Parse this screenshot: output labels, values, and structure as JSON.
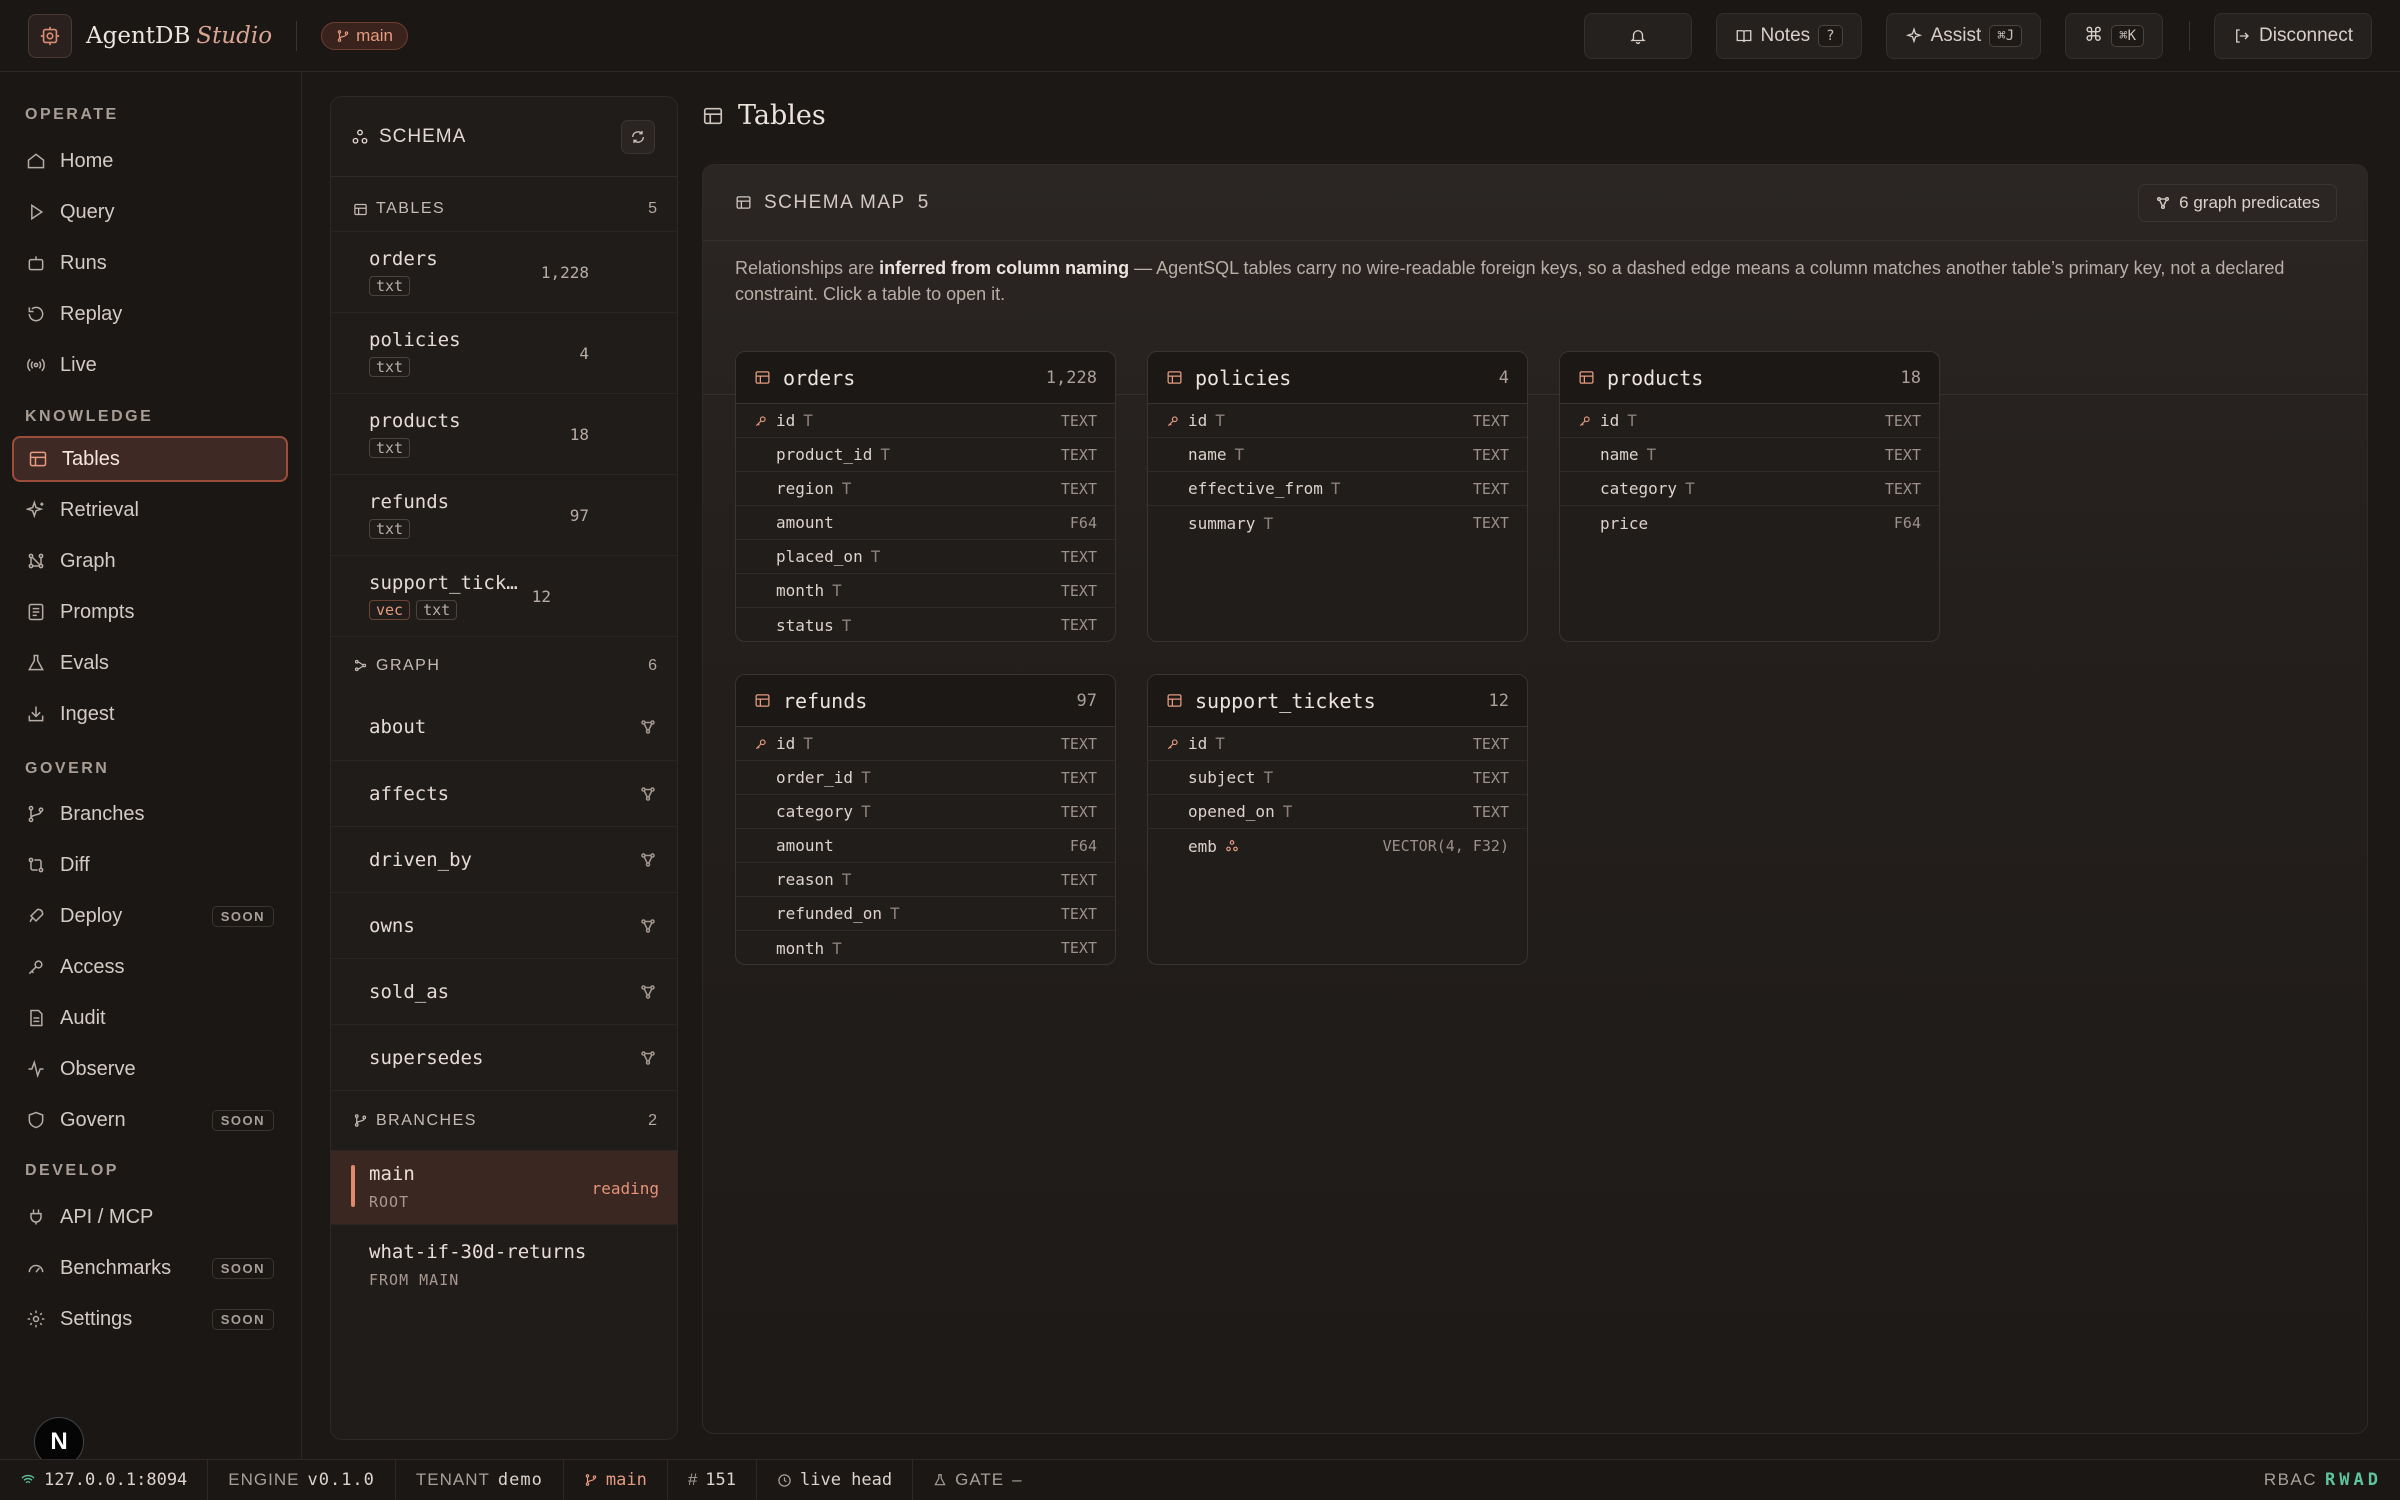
{
  "header": {
    "brand": "AgentDB",
    "brand_suffix": "Studio",
    "branch": "main",
    "notes_label": "Notes",
    "notes_key": "?",
    "assist_label": "Assist",
    "assist_key": "⌘J",
    "cmd_symbol": "⌘",
    "cmd_key": "⌘K",
    "disconnect_label": "Disconnect"
  },
  "sidebar": {
    "sections": [
      "OPERATE",
      "KNOWLEDGE",
      "GOVERN",
      "DEVELOP"
    ],
    "items": [
      {
        "label": "Home",
        "icon": "home-icon"
      },
      {
        "label": "Query",
        "icon": "play-icon"
      },
      {
        "label": "Runs",
        "icon": "bot-icon"
      },
      {
        "label": "Replay",
        "icon": "replay-icon"
      },
      {
        "label": "Live",
        "icon": "broadcast-icon"
      },
      {
        "label": "Tables",
        "icon": "table-icon",
        "active": true
      },
      {
        "label": "Retrieval",
        "icon": "sparkle-icon"
      },
      {
        "label": "Graph",
        "icon": "graph-icon"
      },
      {
        "label": "Prompts",
        "icon": "prompts-icon"
      },
      {
        "label": "Evals",
        "icon": "flask-icon"
      },
      {
        "label": "Ingest",
        "icon": "download-icon"
      },
      {
        "label": "Branches",
        "icon": "branch-icon"
      },
      {
        "label": "Diff",
        "icon": "diff-icon"
      },
      {
        "label": "Deploy",
        "icon": "rocket-icon",
        "badge": "SOON"
      },
      {
        "label": "Access",
        "icon": "key-icon"
      },
      {
        "label": "Audit",
        "icon": "audit-icon"
      },
      {
        "label": "Observe",
        "icon": "activity-icon"
      },
      {
        "label": "Govern",
        "icon": "shield-icon",
        "badge": "SOON"
      },
      {
        "label": "API / MCP",
        "icon": "plug-icon"
      },
      {
        "label": "Benchmarks",
        "icon": "gauge-icon",
        "badge": "SOON"
      },
      {
        "label": "Settings",
        "icon": "gear-icon",
        "badge": "SOON"
      }
    ],
    "avatar_letter": "N"
  },
  "schema": {
    "title": "SCHEMA",
    "tables_label": "TABLES",
    "tables_count": "5",
    "tables": [
      {
        "name": "orders",
        "count": "1,228",
        "tags": [
          "txt"
        ]
      },
      {
        "name": "policies",
        "count": "4",
        "tags": [
          "txt"
        ]
      },
      {
        "name": "products",
        "count": "18",
        "tags": [
          "txt"
        ]
      },
      {
        "name": "refunds",
        "count": "97",
        "tags": [
          "txt"
        ]
      },
      {
        "name": "support_tick…",
        "count": "12",
        "tags": [
          "vec",
          "txt"
        ]
      }
    ],
    "graph_label": "GRAPH",
    "graph_count": "6",
    "predicates": [
      "about",
      "affects",
      "driven_by",
      "owns",
      "sold_as",
      "supersedes"
    ],
    "branches_label": "BRANCHES",
    "branches_count": "2",
    "branches": [
      {
        "name": "main",
        "sub": "ROOT",
        "status": "reading"
      },
      {
        "name": "what-if-30d-returns",
        "sub": "FROM MAIN",
        "status": ""
      }
    ]
  },
  "main": {
    "title": "Tables",
    "map_label": "SCHEMA MAP",
    "map_count": "5",
    "predicates_button": "6 graph predicates",
    "desc_prefix": "Relationships are ",
    "desc_bold": "inferred from column naming",
    "desc_rest": " — AgentSQL tables carry no wire-readable foreign keys, so a dashed edge means a column matches another table’s primary key, not a declared constraint. Click a table to open it.",
    "cards": [
      {
        "name": "orders",
        "count": "1,228",
        "columns": [
          {
            "name": "id",
            "type": "TEXT",
            "key": true,
            "text": true
          },
          {
            "name": "product_id",
            "type": "TEXT",
            "text": true
          },
          {
            "name": "region",
            "type": "TEXT",
            "text": true
          },
          {
            "name": "amount",
            "type": "F64"
          },
          {
            "name": "placed_on",
            "type": "TEXT",
            "text": true
          },
          {
            "name": "month",
            "type": "TEXT",
            "text": true
          },
          {
            "name": "status",
            "type": "TEXT",
            "text": true
          }
        ]
      },
      {
        "name": "policies",
        "count": "4",
        "columns": [
          {
            "name": "id",
            "type": "TEXT",
            "key": true,
            "text": true
          },
          {
            "name": "name",
            "type": "TEXT",
            "text": true
          },
          {
            "name": "effective_from",
            "type": "TEXT",
            "text": true
          },
          {
            "name": "summary",
            "type": "TEXT",
            "text": true
          }
        ]
      },
      {
        "name": "products",
        "count": "18",
        "columns": [
          {
            "name": "id",
            "type": "TEXT",
            "key": true,
            "text": true
          },
          {
            "name": "name",
            "type": "TEXT",
            "text": true
          },
          {
            "name": "category",
            "type": "TEXT",
            "text": true
          },
          {
            "name": "price",
            "type": "F64"
          }
        ]
      },
      {
        "name": "refunds",
        "count": "97",
        "columns": [
          {
            "name": "id",
            "type": "TEXT",
            "key": true,
            "text": true
          },
          {
            "name": "order_id",
            "type": "TEXT",
            "text": true
          },
          {
            "name": "category",
            "type": "TEXT",
            "text": true
          },
          {
            "name": "amount",
            "type": "F64"
          },
          {
            "name": "reason",
            "type": "TEXT",
            "text": true
          },
          {
            "name": "refunded_on",
            "type": "TEXT",
            "text": true
          },
          {
            "name": "month",
            "type": "TEXT",
            "text": true
          }
        ]
      },
      {
        "name": "support_tickets",
        "count": "12",
        "columns": [
          {
            "name": "id",
            "type": "TEXT",
            "key": true,
            "text": true
          },
          {
            "name": "subject",
            "type": "TEXT",
            "text": true
          },
          {
            "name": "opened_on",
            "type": "TEXT",
            "text": true
          },
          {
            "name": "emb",
            "type": "VECTOR(4, F32)",
            "vector": true
          }
        ]
      }
    ]
  },
  "footer": {
    "host": "127.0.0.1:8094",
    "engine_label": "ENGINE",
    "engine_value": "v0.1.0",
    "tenant_label": "TENANT",
    "tenant_value": "demo",
    "branch": "main",
    "head": "151",
    "live": "live head",
    "gate_label": "GATE",
    "gate_value": "–",
    "rbac_label": "RBAC",
    "rbac_value": "RWAD"
  }
}
